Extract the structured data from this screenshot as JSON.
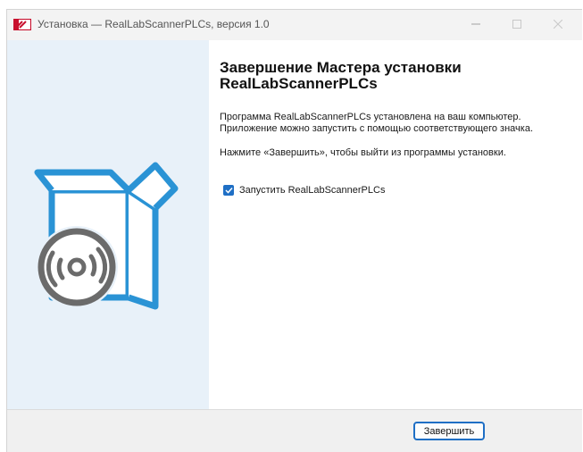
{
  "window": {
    "title": "Установка — RealLabScannerPLCs, версия 1.0"
  },
  "icons": {
    "app": "app-logo-icon",
    "minimize": "minimize-icon",
    "maximize": "maximize-icon",
    "close": "close-icon",
    "installer_art": "box-with-disc-icon",
    "check": "checkmark-icon"
  },
  "main": {
    "heading": "Завершение Мастера установки RealLabScannerPLCs",
    "line1": "Программа RealLabScannerPLCs установлена на ваш компьютер.",
    "line2": "Приложение можно запустить с помощью соответствующего значка.",
    "line3": "Нажмите «Завершить», чтобы выйти из программы установки.",
    "launch_checkbox": {
      "label": "Запустить RealLabScannerPLCs",
      "checked": true
    }
  },
  "footer": {
    "finish_label": "Завершить"
  },
  "colors": {
    "accent": "#1f6fc5",
    "art_blue": "#2a93d5",
    "side_panel": "#e8f1f9",
    "disc_gray": "#6b6b6b"
  }
}
